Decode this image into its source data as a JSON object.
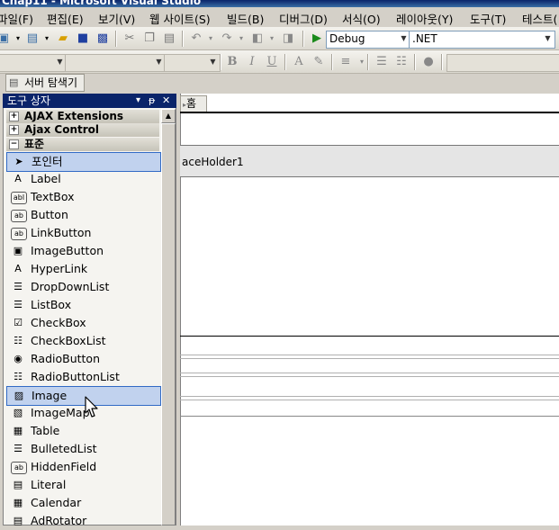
{
  "window": {
    "title": "Chap11 - Microsoft Visual Studio"
  },
  "menu": [
    "파일(F)",
    "편집(E)",
    "보기(V)",
    "웹 사이트(S)",
    "빌드(B)",
    "디버그(D)",
    "서식(O)",
    "레이아웃(Y)",
    "도구(T)",
    "테스트("
  ],
  "toolbar1": {
    "config": "Debug",
    "platform": ".NET"
  },
  "toolbar2": {
    "bold": "B",
    "italic": "I",
    "underline": "U",
    "font_color": "A"
  },
  "server_tab": "서버 탐색기",
  "toolbox": {
    "title": "도구 상자",
    "title_buttons": [
      "▾",
      "ᵽ",
      "✕"
    ],
    "categories": [
      {
        "label": "AJAX Extensions",
        "state": "+"
      },
      {
        "label": "Ajax Control",
        "state": "+"
      },
      {
        "label": "표준",
        "state": "−"
      }
    ],
    "items": [
      {
        "label": "포인터",
        "icon": "pointer-icon",
        "glyph": "➤"
      },
      {
        "label": "Label",
        "icon": "label-icon",
        "glyph": "A"
      },
      {
        "label": "TextBox",
        "icon": "textbox-icon",
        "glyph": "abl"
      },
      {
        "label": "Button",
        "icon": "button-icon",
        "glyph": "ab"
      },
      {
        "label": "LinkButton",
        "icon": "linkbutton-icon",
        "glyph": "ab"
      },
      {
        "label": "ImageButton",
        "icon": "imagebutton-icon",
        "glyph": "▣"
      },
      {
        "label": "HyperLink",
        "icon": "hyperlink-icon",
        "glyph": "A"
      },
      {
        "label": "DropDownList",
        "icon": "dropdownlist-icon",
        "glyph": "☰"
      },
      {
        "label": "ListBox",
        "icon": "listbox-icon",
        "glyph": "☰"
      },
      {
        "label": "CheckBox",
        "icon": "checkbox-icon",
        "glyph": "☑"
      },
      {
        "label": "CheckBoxList",
        "icon": "checkboxlist-icon",
        "glyph": "☷"
      },
      {
        "label": "RadioButton",
        "icon": "radiobutton-icon",
        "glyph": "◉"
      },
      {
        "label": "RadioButtonList",
        "icon": "radiobuttonlist-icon",
        "glyph": "☷"
      },
      {
        "label": "Image",
        "icon": "image-icon",
        "glyph": "▨"
      },
      {
        "label": "ImageMap",
        "icon": "imagemap-icon",
        "glyph": "▧"
      },
      {
        "label": "Table",
        "icon": "table-icon",
        "glyph": "▦"
      },
      {
        "label": "BulletedList",
        "icon": "bulletedlist-icon",
        "glyph": "☰"
      },
      {
        "label": "HiddenField",
        "icon": "hiddenfield-icon",
        "glyph": "ab"
      },
      {
        "label": "Literal",
        "icon": "literal-icon",
        "glyph": "▤"
      },
      {
        "label": "Calendar",
        "icon": "calendar-icon",
        "glyph": "▦"
      },
      {
        "label": "AdRotator",
        "icon": "adrotator-icon",
        "glyph": "▤"
      }
    ],
    "selected_index": 13
  },
  "editor": {
    "doc_tab": "홈",
    "placeholder_label": "aceHolder1"
  }
}
